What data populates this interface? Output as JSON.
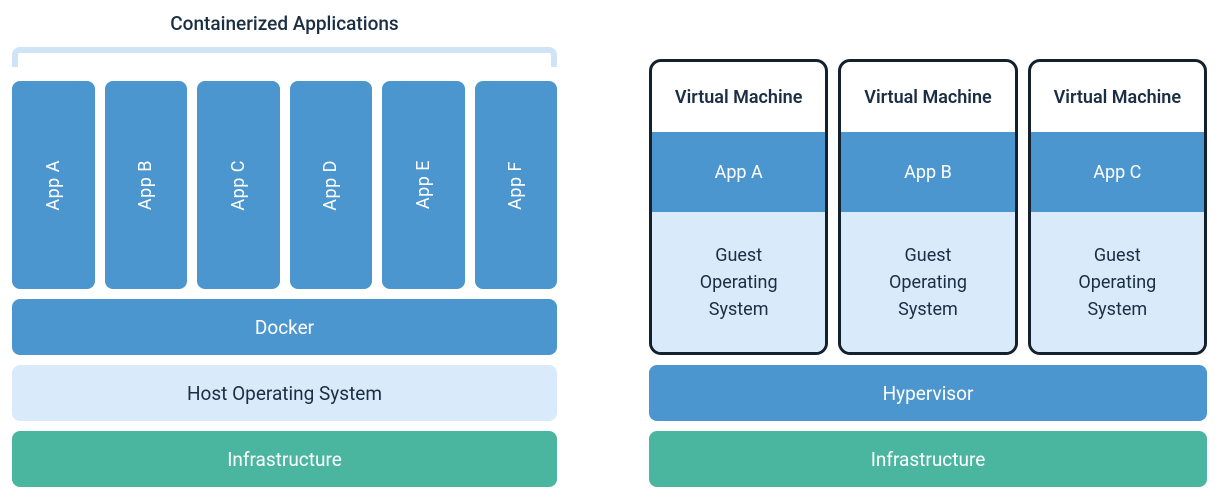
{
  "left": {
    "title": "Containerized Applications",
    "apps": [
      "App A",
      "App B",
      "App C",
      "App D",
      "App E",
      "App F"
    ],
    "docker": "Docker",
    "host_os": "Host Operating System",
    "infrastructure": "Infrastructure"
  },
  "right": {
    "vms": [
      {
        "title": "Virtual Machine",
        "app": "App A",
        "guest": "Guest\nOperating\nSystem"
      },
      {
        "title": "Virtual Machine",
        "app": "App B",
        "guest": "Guest\nOperating\nSystem"
      },
      {
        "title": "Virtual Machine",
        "app": "App C",
        "guest": "Guest\nOperating\nSystem"
      }
    ],
    "hypervisor": "Hypervisor",
    "infrastructure": "Infrastructure"
  },
  "colors": {
    "blue_mid": "#4c96cf",
    "blue_light": "#d9ebfa",
    "green": "#4bb6a0",
    "dark_navy": "#1a2e44"
  }
}
